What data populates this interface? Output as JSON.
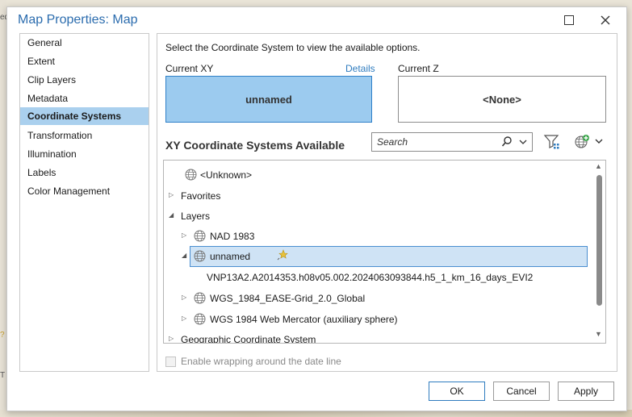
{
  "window": {
    "title": "Map Properties: Map"
  },
  "background": {
    "fragment_top": "ed",
    "fragment_mid": "?",
    "fragment_low": "T"
  },
  "nav": {
    "items": [
      {
        "label": "General"
      },
      {
        "label": "Extent"
      },
      {
        "label": "Clip Layers"
      },
      {
        "label": "Metadata"
      },
      {
        "label": "Coordinate Systems",
        "active": true
      },
      {
        "label": "Transformation"
      },
      {
        "label": "Illumination"
      },
      {
        "label": "Labels"
      },
      {
        "label": "Color Management"
      }
    ]
  },
  "coord": {
    "instruction": "Select the Coordinate System to view the available options.",
    "current_xy_label": "Current XY",
    "details_link": "Details",
    "current_z_label": "Current Z",
    "current_xy_value": "unnamed",
    "current_z_value": "<None>",
    "available_heading": "XY Coordinate Systems Available",
    "search_placeholder": "Search"
  },
  "tree": {
    "unknown": "<Unknown>",
    "favorites": "Favorites",
    "layers": "Layers",
    "nad1983": "NAD 1983",
    "unnamed": "unnamed",
    "vnp_layer": "VNP13A2.A2014353.h08v05.002.2024063093844.h5_1_km_16_days_EVI2",
    "wgs_ease": "WGS_1984_EASE-Grid_2.0_Global",
    "wgs_web": "WGS 1984 Web Mercator (auxiliary sphere)",
    "geographic": "Geographic Coordinate System"
  },
  "options": {
    "wrap_label": "Enable wrapping around the date line",
    "wrap_checked": false
  },
  "buttons": {
    "ok": "OK",
    "cancel": "Cancel",
    "apply": "Apply"
  },
  "colors": {
    "accent": "#2f7cbf",
    "selection": "#aad0ee",
    "current_xy_fill": "#9ccbef"
  }
}
